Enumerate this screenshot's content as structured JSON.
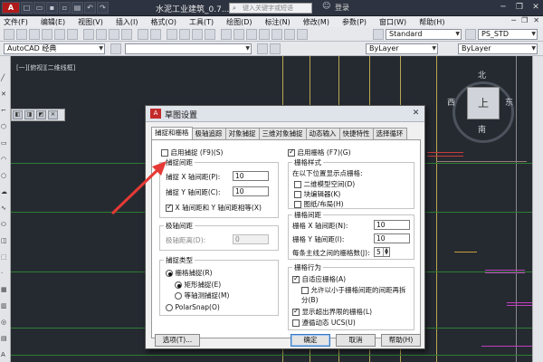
{
  "window": {
    "title": "水泥工业建筑_0.7...",
    "search_placeholder": "键入关键字或短语",
    "login_label": "登录",
    "controls": [
      "minimize-icon",
      "restore-icon",
      "close-icon"
    ]
  },
  "menu": {
    "items": [
      "文件(F)",
      "编辑(E)",
      "视图(V)",
      "插入(I)",
      "格式(O)",
      "工具(T)",
      "绘图(D)",
      "标注(N)",
      "修改(M)",
      "参数(P)",
      "窗口(W)",
      "帮助(H)"
    ]
  },
  "toolbar": {
    "text_style": "Standard",
    "dim_style": "PS_STD",
    "workspace": "AutoCAD 经典",
    "layer_color": "ByLayer",
    "linetype": "ByLayer"
  },
  "canvas": {
    "viewport_label": "[一][俯视][二维线框]",
    "viewcube_face": "上",
    "compass": {
      "north": "北",
      "south": "南",
      "east": "东",
      "west": "西"
    },
    "colors": {
      "background": "#252a31",
      "green_lines": "#2e7d32",
      "magenta_lines": "#c040c0",
      "annotation_arrow": "#e53935"
    }
  },
  "dialog": {
    "title": "草图设置",
    "tabs": [
      {
        "label": "捕捉和栅格",
        "active": true
      },
      {
        "label": "极轴追踪",
        "active": false
      },
      {
        "label": "对象捕捉",
        "active": false
      },
      {
        "label": "三维对象捕捉",
        "active": false
      },
      {
        "label": "动态输入",
        "active": false
      },
      {
        "label": "快捷特性",
        "active": false
      },
      {
        "label": "选择循环",
        "active": false
      }
    ],
    "snap_on_label": "启用捕捉 (F9)(S)",
    "snap_on": false,
    "grid_on_label": "启用栅格 (F7)(G)",
    "grid_on": true,
    "snap_spacing": {
      "title": "捕捉间距",
      "x_label": "捕捉 X 轴间距(P):",
      "x_value": "10",
      "y_label": "捕捉 Y 轴间距(C):",
      "y_value": "10",
      "equal_label": "X 轴间距和 Y 轴间距相等(X)",
      "equal_checked": true
    },
    "polar_spacing": {
      "title": "极轴间距",
      "distance_label": "极轴距离(D):",
      "distance_value": "0"
    },
    "snap_type": {
      "title": "捕捉类型",
      "grid_snap_label": "栅格捕捉(R)",
      "rect_snap_label": "矩形捕捉(E)",
      "iso_snap_label": "等轴测捕捉(M)",
      "polar_snap_label": "PolarSnap(O)"
    },
    "grid_style": {
      "title": "栅格样式",
      "desc": "在以下位置显示点栅格:",
      "model_space_label": "二维模型空间(D)",
      "block_editor_label": "块编辑器(K)",
      "sheet_layout_label": "图纸/布局(H)"
    },
    "grid_spacing": {
      "title": "栅格间距",
      "x_label": "栅格 X 轴间距(N):",
      "x_value": "10",
      "y_label": "栅格 Y 轴间距(I):",
      "y_value": "10",
      "major_label": "每条主线之间的栅格数(J):",
      "major_value": "5"
    },
    "grid_behavior": {
      "title": "栅格行为",
      "adaptive_label": "自适应栅格(A)",
      "subdivide_label": "允许以小于栅格间距的间距再拆分(B)",
      "beyond_limits_label": "显示超出界限的栅格(L)",
      "follow_ucs_label": "遵循动态 UCS(U)"
    },
    "buttons": {
      "options": "选项(T)...",
      "ok": "确定",
      "cancel": "取消",
      "help": "帮助(H)"
    }
  }
}
